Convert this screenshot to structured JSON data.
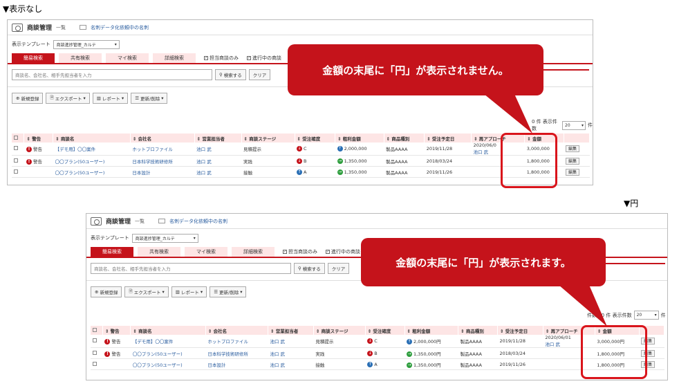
{
  "captions": {
    "top": "▼表示なし",
    "bottom": "▼円"
  },
  "colors": {
    "accent": "#c5131b",
    "link": "#2a5d9f",
    "header_bg": "#fde5e5"
  },
  "app": {
    "title": "商談管理",
    "subtitle": "一覧",
    "card_link": "名刺データ化依頼中の名刺",
    "template_label": "表示テンプレート",
    "template_value": "商談進捗管理_カルテ",
    "tabs": [
      "簡易検索",
      "共有検索",
      "マイ検索",
      "詳細検索"
    ],
    "check_mine": "担当商談のみ",
    "check_active": "進行中の商談",
    "search_placeholder": "商談名、会社名、相手先担当者を入力",
    "search_button": "検索する",
    "clear_button": "クリア",
    "actions": [
      "新規登録",
      "エクスポート",
      "レポート",
      "更新/削除"
    ],
    "pager_top": "0 件 表示件数",
    "pager_bottom": "件数 60 件 表示件数",
    "per_page": "20",
    "per_page_unit": "件",
    "edit_label": "編集",
    "columns": [
      "警告",
      "商談名",
      "会社名",
      "営業担当者",
      "商談ステージ",
      "受注確度",
      "粗利金額",
      "商品種別",
      "受注予定日",
      "再アプローチ",
      "金額"
    ]
  },
  "panel_top": {
    "rows": [
      {
        "warn": "警告",
        "name": "【デモ用】〇〇案件",
        "company": "ホットプロファイル",
        "rep": "池口 武",
        "stage": "見積提示",
        "prob": "C",
        "prob_dir": "down",
        "profit": "2,000,000",
        "profit_dir": "up",
        "product": "製品AAAA",
        "date": "2019/11/28",
        "reapproach": "2020/06/0",
        "reapproach2": "池口 武",
        "amount": "3,000,000"
      },
      {
        "warn": "警告",
        "name": "〇〇プラン(50ユーザー)",
        "company": "日本科学技術研修所",
        "rep": "池口 武",
        "stage": "実践",
        "prob": "B",
        "prob_dir": "down",
        "profit": "1,350,000",
        "profit_dir": "right",
        "product": "製品AAAA",
        "date": "2018/03/24",
        "reapproach": "",
        "reapproach2": "",
        "amount": "1,800,000"
      },
      {
        "warn": "",
        "name": "〇〇プラン(50ユーザー)",
        "company": "日本設計",
        "rep": "池口 武",
        "stage": "接触",
        "prob": "A",
        "prob_dir": "up",
        "profit": "1,350,000",
        "profit_dir": "right",
        "product": "製品AAAA",
        "date": "2019/11/26",
        "reapproach": "",
        "reapproach2": "",
        "amount": "1,800,000"
      }
    ],
    "callout": "金額の末尾に「円」が表示されません。"
  },
  "panel_bottom": {
    "rows": [
      {
        "warn": "警告",
        "name": "【デモ用】〇〇案件",
        "company": "ホットプロファイル",
        "rep": "池口 武",
        "stage": "見積提示",
        "prob": "C",
        "prob_dir": "down",
        "profit": "2,000,000円",
        "profit_dir": "up",
        "product": "製品AAAA",
        "date": "2019/11/28",
        "reapproach": "2020/06/01",
        "reapproach2": "池口 武",
        "amount": "3,000,000円"
      },
      {
        "warn": "警告",
        "name": "〇〇プラン(50ユーザー)",
        "company": "日本科学技術研修所",
        "rep": "池口 武",
        "stage": "実践",
        "prob": "B",
        "prob_dir": "down",
        "profit": "1,350,000円",
        "profit_dir": "right",
        "product": "製品AAAA",
        "date": "2018/03/24",
        "reapproach": "",
        "reapproach2": "",
        "amount": "1,800,000円"
      },
      {
        "warn": "",
        "name": "〇〇プラン(50ユーザー)",
        "company": "日本設計",
        "rep": "池口 武",
        "stage": "接触",
        "prob": "A",
        "prob_dir": "up",
        "profit": "1,350,000円",
        "profit_dir": "right",
        "product": "製品AAAA",
        "date": "2019/11/26",
        "reapproach": "",
        "reapproach2": "",
        "amount": "1,800,000円"
      }
    ],
    "callout": "金額の末尾に「円」が表示されます。"
  }
}
